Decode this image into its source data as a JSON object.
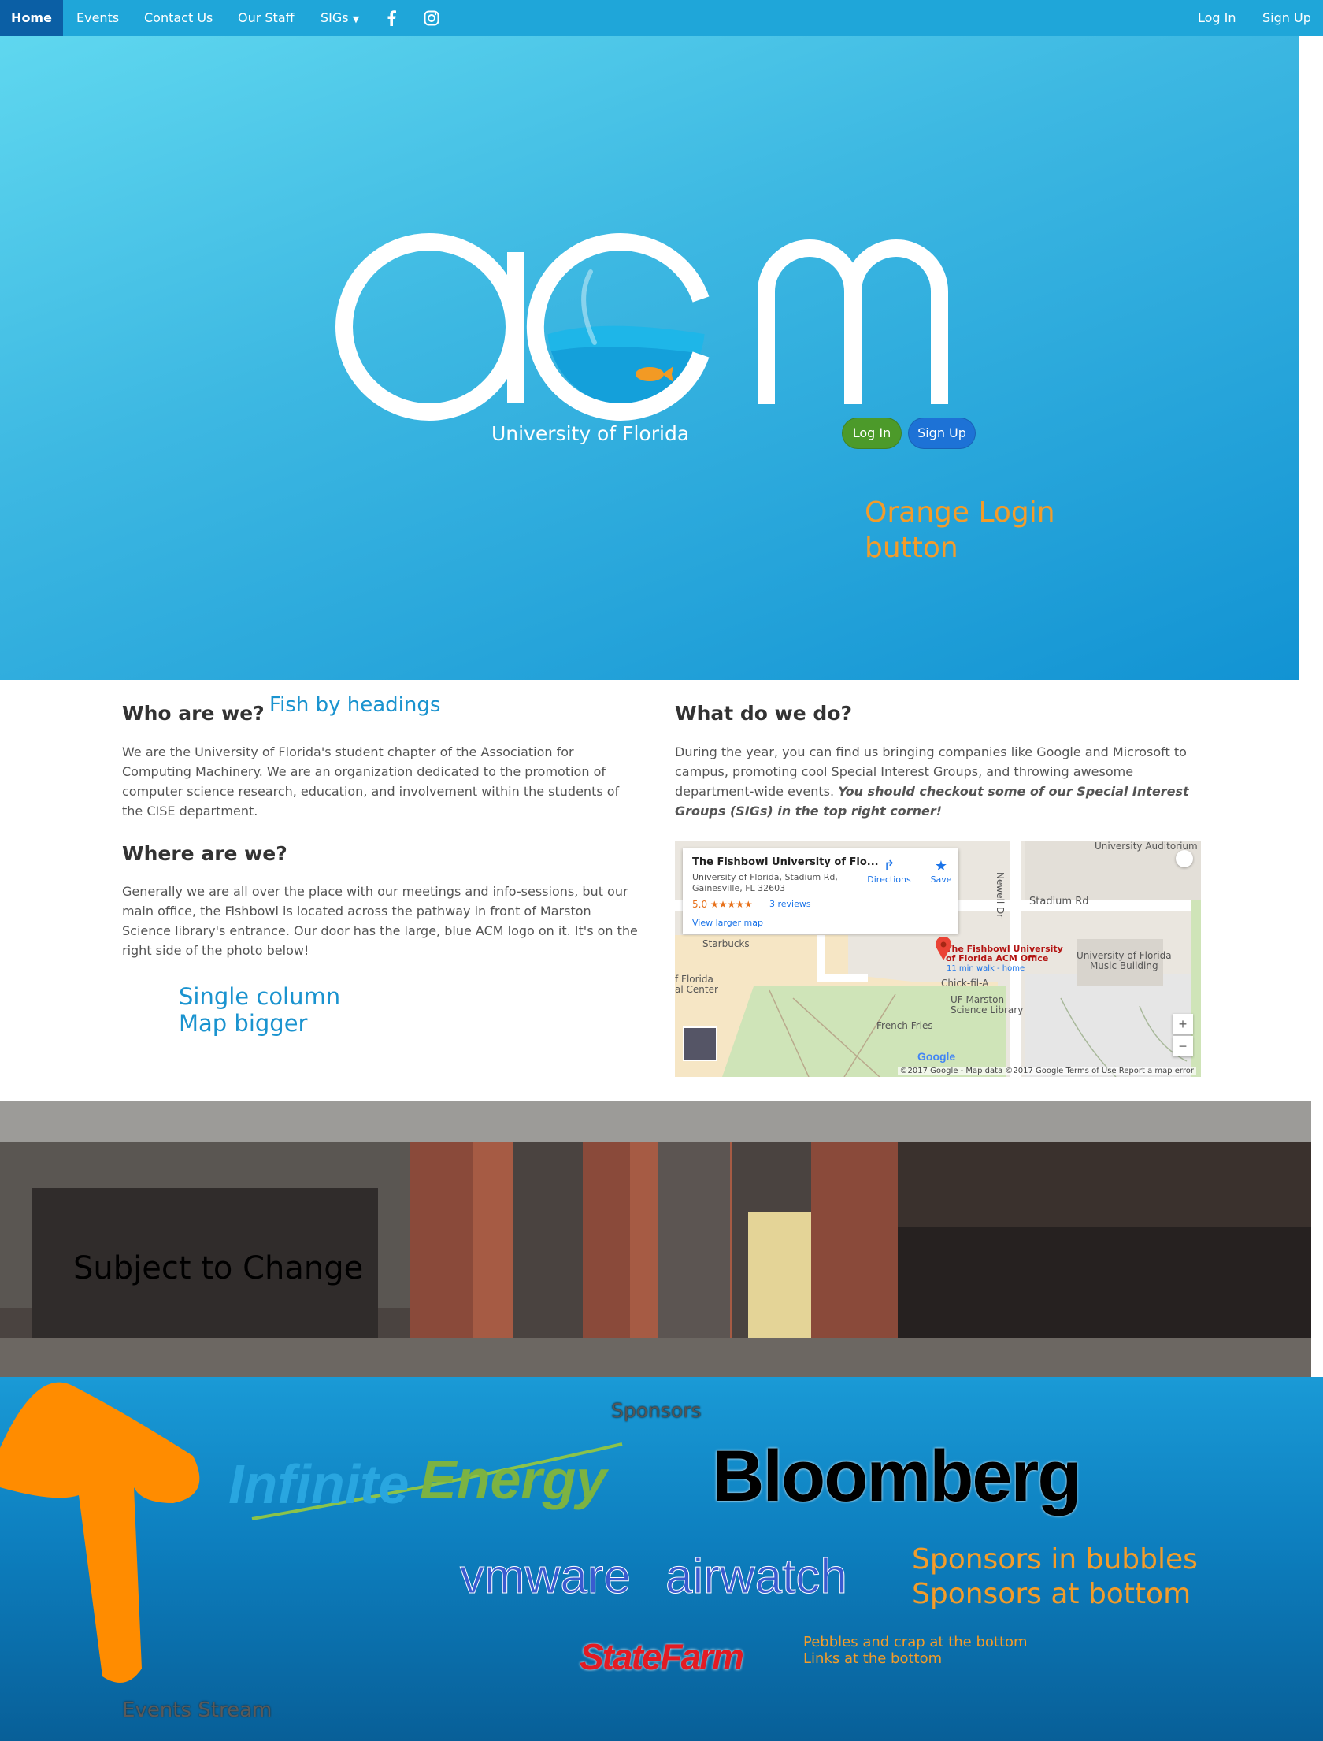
{
  "nav": {
    "home": "Home",
    "events": "Events",
    "contact": "Contact Us",
    "staff": "Our Staff",
    "sigs": "SIGs",
    "login": "Log In",
    "signup": "Sign Up",
    "facebook_icon": "facebook-icon",
    "instagram_icon": "instagram-icon"
  },
  "hero": {
    "logo_text": "acm",
    "subtitle": "University of Florida",
    "login_button": "Log In",
    "signup_button": "Sign Up"
  },
  "notes": {
    "orange_login": [
      "Orange Login",
      "button"
    ],
    "fish_headings": "Fish by headings",
    "single_column": [
      "Single column",
      "Map bigger"
    ],
    "subject_change": "Subject to Change",
    "sponsors_bubbles": [
      "Sponsors in bubbles",
      "Sponsors at bottom"
    ],
    "pebbles": [
      "Pebbles and crap at the bottom",
      "Links at the bottom"
    ],
    "events_stream": "Events Stream"
  },
  "about": {
    "who_heading": "Who are we?",
    "who_text": "We are the University of Florida's student chapter of the Association for Computing Machinery. We are an organization dedicated to the promotion of computer science research, education, and involvement within the students of the CISE department.",
    "where_heading": "Where are we?",
    "where_text": "Generally we are all over the place with our meetings and info-sessions, but our main office, the Fishbowl is located across the pathway in front of Marston Science library's entrance. Our door has the large, blue ACM logo on it. It's on the right side of the photo below!",
    "what_heading": "What do we do?",
    "what_text": "During the year, you can find us bringing companies like Google and Microsoft to campus, promoting cool Special Interest Groups, and throwing awesome department-wide events.",
    "what_emphasis": "You should checkout some of our Special Interest Groups (SIGs) in the top right corner!"
  },
  "map": {
    "place_title": "The Fishbowl University of Flo...",
    "address": "University of Florida, Stadium Rd, Gainesville, FL 32603",
    "rating": "5.0 ★★★★★",
    "reviews": "3 reviews",
    "larger": "View larger map",
    "directions": "Directions",
    "save": "Save",
    "labels": {
      "auditorium": "University Auditorium",
      "stadium": "Stadium Rd",
      "newell": "Newell Dr",
      "starbucks": "Starbucks",
      "florida_center": "f Florida\nal Center",
      "fishbowl": "The Fishbowl University\nof Florida ACM Office",
      "walk": "11 min walk - home",
      "chick": "Chick-fil-A",
      "marston": "UF Marston\nScience Library",
      "french": "French Fries",
      "music": "University of Florida\nMusic Building"
    },
    "zoom_in": "+",
    "zoom_out": "−",
    "footer": "©2017 Google - Map data ©2017 Google   Terms of Use   Report a map error",
    "google": "Google"
  },
  "sponsors": {
    "title": "Sponsors",
    "infinite_a": "Infinite",
    "infinite_b": "Energy",
    "bloomberg": "Bloomberg",
    "vmware": "vmware",
    "airwatch": "airwatch",
    "statefarm": "StateFarm"
  }
}
